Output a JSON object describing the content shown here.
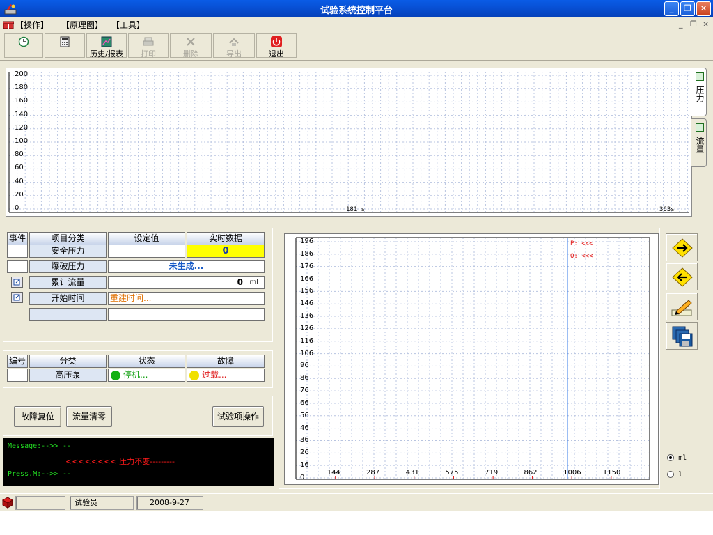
{
  "window": {
    "title": "试验系统控制平台",
    "minimize": "_",
    "restore": "❐",
    "close": "✕"
  },
  "menu": {
    "items": [
      "【操作】",
      "【原理图】",
      "【工具】"
    ],
    "mdi_controls": [
      "_",
      "❐",
      "×"
    ]
  },
  "toolbar": {
    "history_label": "历史/报表",
    "print_label": "打印",
    "delete_label": "删除",
    "export_label": "导出",
    "exit_label": "退出"
  },
  "top_chart": {
    "y_ticks": [
      "200",
      "180",
      "160",
      "140",
      "120",
      "100",
      "80",
      "60",
      "40",
      "20",
      "0"
    ],
    "x_mid_label": "181 s",
    "x_end_label": "363s"
  },
  "tabs": {
    "pressure": "压力",
    "flow": "流量"
  },
  "params_table": {
    "headers": {
      "event": "事件",
      "category": "项目分类",
      "setpoint": "设定值",
      "realtime": "实时数据"
    },
    "safe_pressure": {
      "label": "安全压力",
      "setpoint": "--",
      "realtime": "0"
    },
    "burst_pressure": {
      "label": "爆破压力",
      "value": "未生成..."
    },
    "cumulative_flow": {
      "label": "累计流量",
      "value": "0",
      "unit": "ml"
    },
    "start_time": {
      "label": "开始时间",
      "value": "重建时间..."
    }
  },
  "pump_table": {
    "headers": {
      "id": "编号",
      "category": "分类",
      "state": "状态",
      "fault": "故障"
    },
    "row": {
      "category": "高压泵",
      "state": "停机...",
      "fault": "过载..."
    },
    "colors": {
      "state_dot": "#12b012",
      "fault_dot": "#f0e000"
    }
  },
  "actions": {
    "fault_reset": "故障复位",
    "flow_reset": "流量清零",
    "test_ops": "试验项操作"
  },
  "console": {
    "message_prefix": "Message:-->>",
    "message_value": "--",
    "alert_line": "<<<<<<<< 压力不变---------",
    "press_prefix": "Press.M:-->>",
    "press_value": "--"
  },
  "right_chart": {
    "y_ticks": [
      "196",
      "186",
      "176",
      "166",
      "156",
      "146",
      "136",
      "126",
      "116",
      "106",
      "96",
      "86",
      "76",
      "66",
      "56",
      "46",
      "36",
      "26",
      "16",
      "0"
    ],
    "x_ticks": [
      "144",
      "287",
      "431",
      "575",
      "719",
      "862",
      "1006",
      "1150"
    ],
    "legend_p": "P: <<<",
    "legend_q": "Q: <<<",
    "colors": {
      "cursor": "#3a7de8",
      "legend": "#e01010"
    }
  },
  "units": {
    "ml": "ml",
    "l": "l",
    "selected": "ml"
  },
  "statusbar": {
    "user": "试验员",
    "date": "2008-9-27"
  }
}
